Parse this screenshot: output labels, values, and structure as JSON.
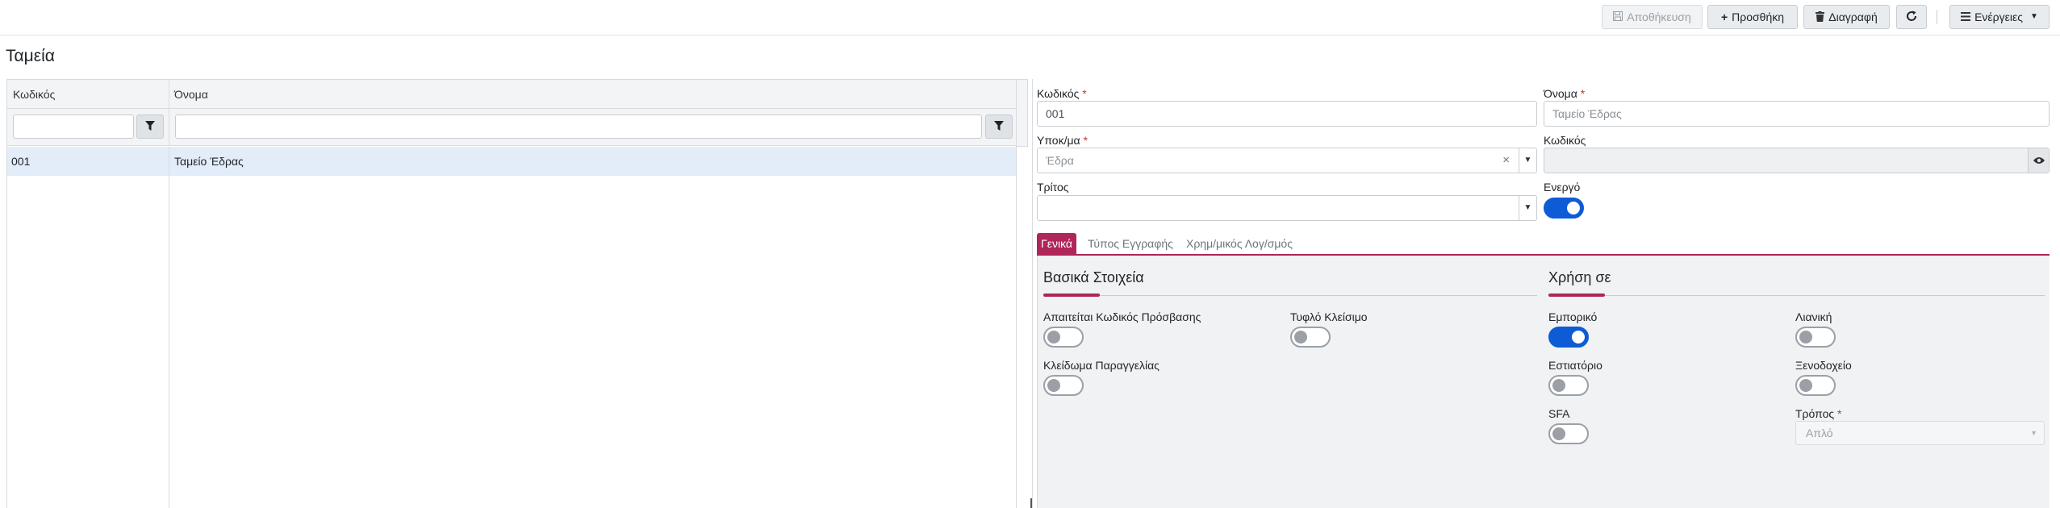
{
  "toolbar": {
    "save_label": "Αποθήκευση",
    "add_label": "Προσθήκη",
    "delete_label": "Διαγραφή",
    "actions_label": "Ενέργειες"
  },
  "page": {
    "title": "Ταμεία"
  },
  "grid": {
    "columns": [
      "Κωδικός",
      "Όνομα"
    ],
    "rows": [
      {
        "code": "001",
        "name": "Ταμείο Έδρας"
      }
    ]
  },
  "form": {
    "code": {
      "label": "Κωδικός",
      "value": "001"
    },
    "name": {
      "label": "Όνομα",
      "placeholder": "Ταμείο Έδρας"
    },
    "branch": {
      "label": "Υποκ/μα",
      "value": "Έδρα"
    },
    "code2": {
      "label": "Κωδικός",
      "value": ""
    },
    "third": {
      "label": "Τρίτος",
      "value": ""
    },
    "active": {
      "label": "Ενεργό",
      "on": true
    }
  },
  "tabs": [
    "Γενικά",
    "Τύπος Εγγραφής",
    "Χρημ/μικός Λογ/σμός"
  ],
  "active_tab": "Γενικά",
  "basic": {
    "title": "Βασικά Στοιχεία",
    "require_password": {
      "label": "Απαιτείται Κωδικός Πρόσβασης",
      "on": false
    },
    "blind_close": {
      "label": "Τυφλό Κλείσιμο",
      "on": false
    },
    "order_lock": {
      "label": "Κλείδωμα Παραγγελίας",
      "on": false
    }
  },
  "usage": {
    "title": "Χρήση σε",
    "commercial": {
      "label": "Εμπορικό",
      "on": true
    },
    "retail": {
      "label": "Λιανική",
      "on": false
    },
    "restaurant": {
      "label": "Εστιατόριο",
      "on": false
    },
    "hotel": {
      "label": "Ξενοδοχείο",
      "on": false
    },
    "sfa": {
      "label": "SFA",
      "on": false
    },
    "mode": {
      "label": "Τρόπος",
      "value": "Απλό"
    }
  },
  "colors": {
    "accent": "#b0255a",
    "toggle_on": "#0d5cd6",
    "selected_row": "#e3ecf9"
  }
}
